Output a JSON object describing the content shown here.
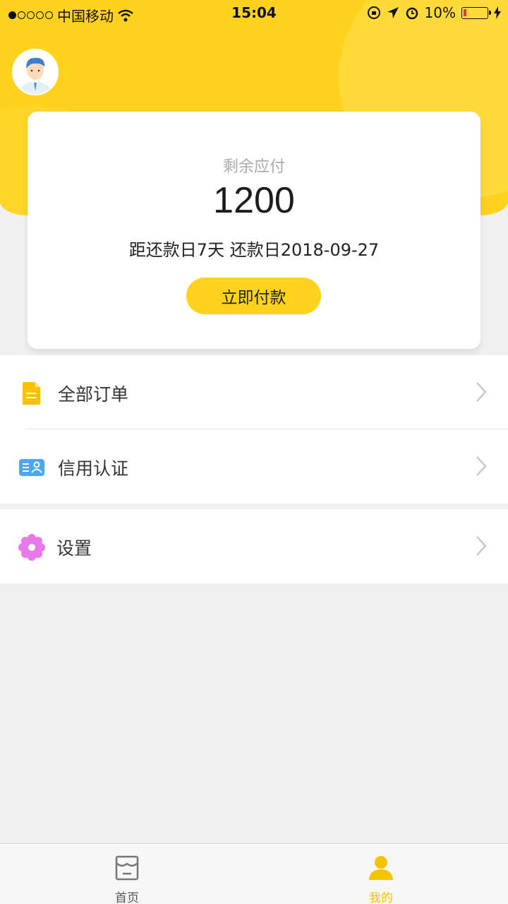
{
  "status_bar": {
    "carrier": "中国移动",
    "time": "15:04",
    "battery_percent": "10%"
  },
  "card": {
    "label": "剩余应付",
    "amount": "1200",
    "due_text": "距还款日7天 还款日2018-09-27",
    "pay_button": "立即付款"
  },
  "menu": [
    {
      "label": "全部订单",
      "icon": "document-icon"
    },
    {
      "label": "信用认证",
      "icon": "id-card-icon"
    },
    {
      "label": "设置",
      "icon": "settings-flower-icon"
    }
  ],
  "tabbar": {
    "home_label": "首页",
    "mine_label": "我的",
    "active": "mine"
  },
  "colors": {
    "accent": "#ffd21e",
    "active_tab": "#f5c400"
  }
}
